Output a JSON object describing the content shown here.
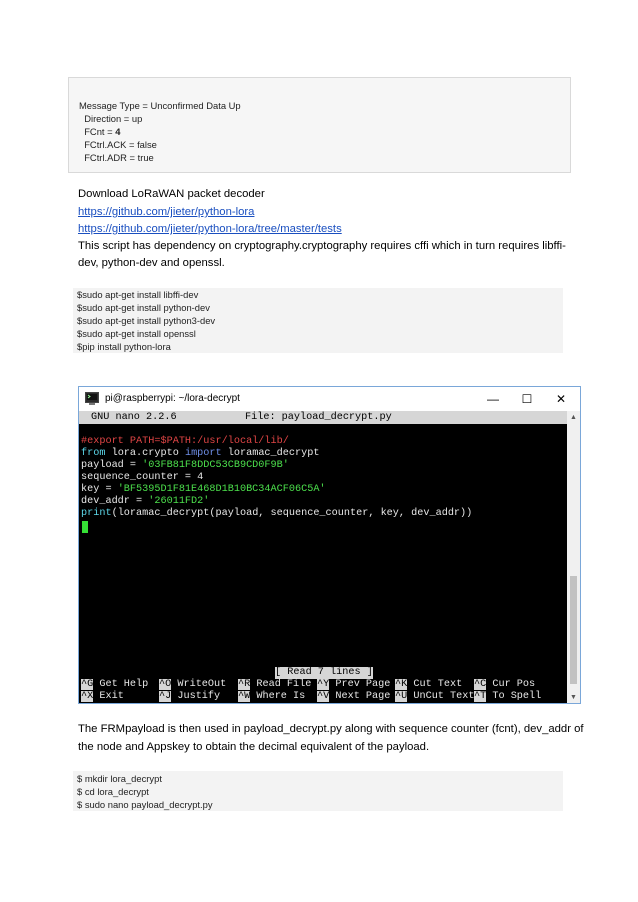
{
  "message_box": {
    "lines": [
      "Message Type = Unconfirmed Data Up",
      "  Direction = up",
      "  FCnt = ",
      "  FCtrl.ACK = false",
      "  FCtrl.ADR = true"
    ],
    "fcnt_value": "4"
  },
  "section1": {
    "heading": "Download LoRaWAN packet decoder",
    "link1": "https://github.com/jieter/python-lora",
    "link2": "https://github.com/jieter/python-lora/tree/master/tests",
    "dep_line1": "This script has dependency on cryptography.cryptography requires cffi which in turn requires libffi-",
    "dep_line2": "dev, python-dev and openssl."
  },
  "install_commands": [
    "$sudo apt-get install libffi-dev",
    "$sudo apt-get install python-dev",
    "$sudo apt-get install python3-dev",
    "$sudo apt-get install openssl",
    "$pip install python-lora"
  ],
  "terminal": {
    "window_title": "pi@raspberrypi: ~/lora-decrypt",
    "nano_version": "GNU nano 2.2.6",
    "file_label": "File: payload_decrypt.py",
    "code": {
      "l1": "#export PATH=$PATH:/usr/local/lib/",
      "l2_from": "from",
      "l2_mod": " lora.crypto ",
      "l2_import": "import",
      "l2_name": " loramac_decrypt",
      "l3_var": "payload = ",
      "l3_str": "'03FB81F8DDC53CB9CD0F9B'",
      "l4": "sequence_counter = 4",
      "l5_var": "key = ",
      "l5_str": "'BF5395D1F81E468D1B10BC34ACF06C5A'",
      "l6_var": "dev_addr = ",
      "l6_str": "'26011FD2'",
      "l7_print": "print",
      "l7_rest": "(loramac_decrypt(payload, sequence_counter, key, dev_addr))"
    },
    "status_message": "[ Read 7 lines ]",
    "shortcuts_row1": [
      {
        "key": "^G",
        "label": " Get Help"
      },
      {
        "key": "^O",
        "label": " WriteOut"
      },
      {
        "key": "^R",
        "label": " Read File"
      },
      {
        "key": "^Y",
        "label": " Prev Page"
      },
      {
        "key": "^K",
        "label": " Cut Text"
      },
      {
        "key": "^C",
        "label": " Cur Pos"
      }
    ],
    "shortcuts_row2": [
      {
        "key": "^X",
        "label": " Exit"
      },
      {
        "key": "^J",
        "label": " Justify"
      },
      {
        "key": "^W",
        "label": " Where Is"
      },
      {
        "key": "^V",
        "label": " Next Page"
      },
      {
        "key": "^U",
        "label": " UnCut Text"
      },
      {
        "key": "^T",
        "label": " To Spell"
      }
    ],
    "controls": {
      "minimize": "—",
      "maximize": "☐",
      "close": "✕"
    }
  },
  "section2": {
    "line1": "The FRMpayload is then used in payload_decrypt.py along with sequence counter (fcnt), dev_addr of",
    "line2": "the node and Appskey to obtain the decimal equivalent of the payload."
  },
  "setup_commands": [
    "$ mkdir lora_decrypt",
    "$ cd lora_decrypt",
    "$ sudo nano payload_decrypt.py"
  ]
}
